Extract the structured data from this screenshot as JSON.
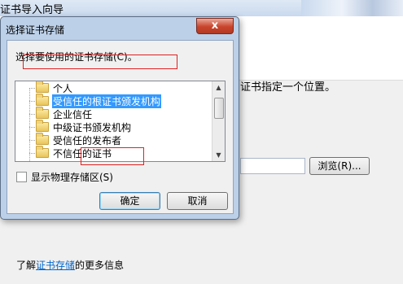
{
  "wizard": {
    "title": "证书导入向导",
    "instruction_partial": "证书指定一个位置。",
    "browse_label": "浏览(R)...",
    "more_info_prefix": "了解",
    "more_info_link": "证书存储",
    "more_info_suffix": "的更多信息"
  },
  "dialog": {
    "title": "选择证书存储",
    "close_glyph": "x",
    "prompt": "选择要使用的证书存储(C)。",
    "tree_items": [
      {
        "label": "个人",
        "selected": false
      },
      {
        "label": "受信任的根证书颁发机构",
        "selected": true
      },
      {
        "label": "企业信任",
        "selected": false
      },
      {
        "label": "中级证书颁发机构",
        "selected": false
      },
      {
        "label": "受信任的发布者",
        "selected": false
      },
      {
        "label": "不信任的证书",
        "selected": false
      }
    ],
    "show_physical_label": "显示物理存储区(S)",
    "ok_label": "确定",
    "cancel_label": "取消"
  },
  "colors": {
    "selection": "#3399ff",
    "annotation_red": "#e02020",
    "link": "#0066cc"
  }
}
